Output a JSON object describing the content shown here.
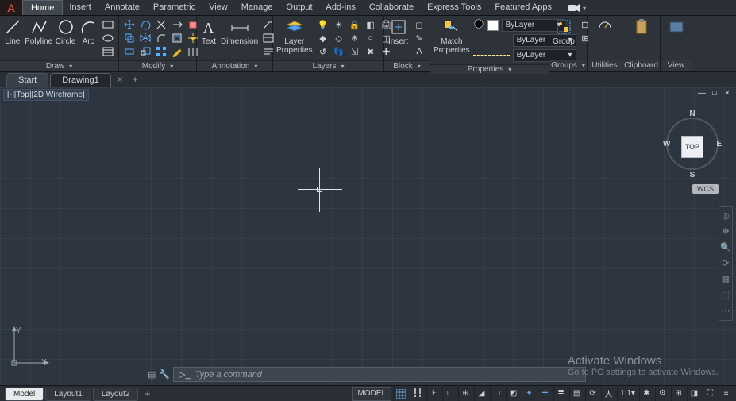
{
  "titlebar": {
    "menu": [
      "Home",
      "Insert",
      "Annotate",
      "Parametric",
      "View",
      "Manage",
      "Output",
      "Add-ins",
      "Collaborate",
      "Express Tools",
      "Featured Apps"
    ]
  },
  "ribbon": {
    "draw": {
      "title": "Draw",
      "buttons": {
        "line": "Line",
        "polyline": "Polyline",
        "circle": "Circle",
        "arc": "Arc"
      }
    },
    "modify": {
      "title": "Modify"
    },
    "annotation": {
      "title": "Annotation",
      "buttons": {
        "text": "Text",
        "dimension": "Dimension"
      }
    },
    "layers": {
      "title": "Layers",
      "buttons": {
        "layer_properties": "Layer\nProperties"
      }
    },
    "block": {
      "title": "Block",
      "buttons": {
        "insert": "Insert"
      }
    },
    "properties": {
      "title": "Properties",
      "buttons": {
        "match": "Match\nProperties"
      },
      "bylayer": "ByLayer"
    },
    "groups": {
      "title": "Groups",
      "buttons": {
        "group": "Group"
      }
    },
    "utilities": {
      "title": "Utilities"
    },
    "clipboard": {
      "title": "Clipboard"
    },
    "view": {
      "title": "View"
    }
  },
  "doc_tabs": {
    "start": "Start",
    "drawing": "Drawing1"
  },
  "viewport": {
    "label": "[-][Top][2D Wireframe]",
    "cube_face": "TOP",
    "compass": {
      "n": "N",
      "s": "S",
      "e": "E",
      "w": "W"
    },
    "wcs": "WCS",
    "ucs": {
      "x": "X",
      "y": "Y"
    },
    "cmd_placeholder": "Type a command",
    "activate": {
      "hdr": "Activate Windows",
      "sub": "Go to PC settings to activate Windows."
    }
  },
  "footer": {
    "model": "Model",
    "layout1": "Layout1",
    "layout2": "Layout2",
    "model_btn": "MODEL",
    "scale": "1:1"
  }
}
